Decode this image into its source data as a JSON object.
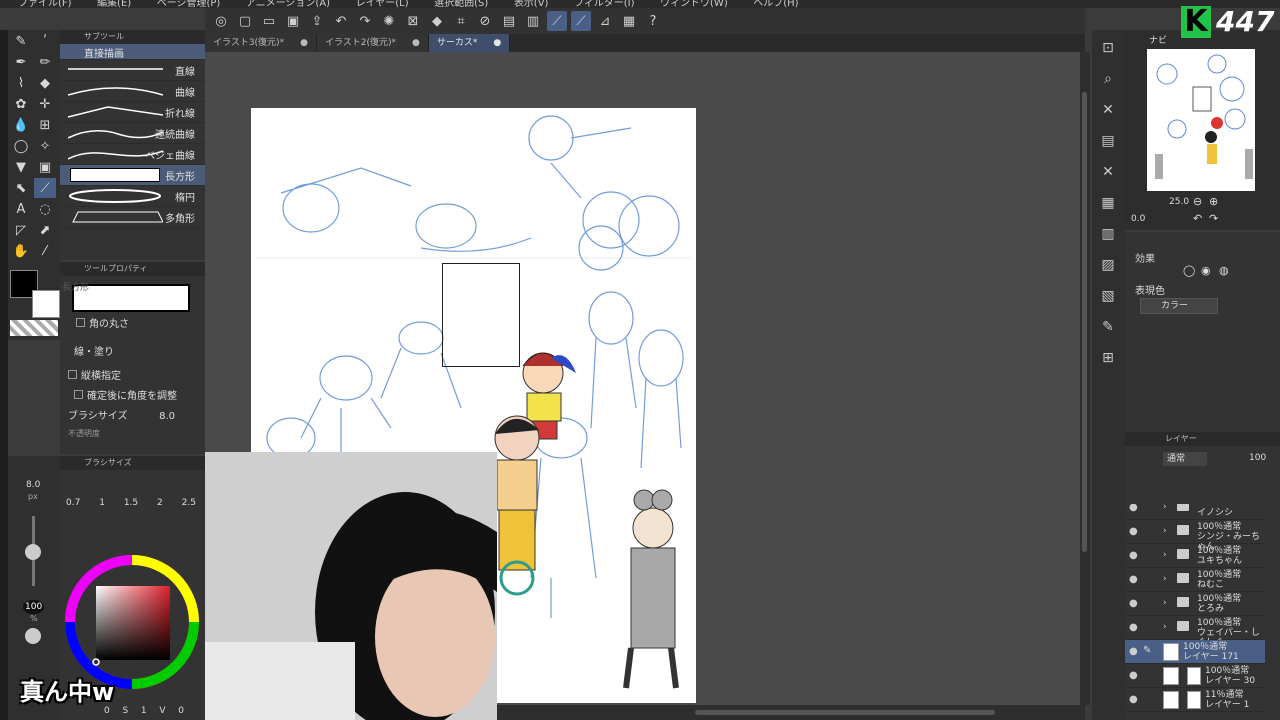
{
  "menu": [
    "ファイル(F)",
    "編集(E)",
    "ページ管理(P)",
    "アニメーション(A)",
    "レイヤー(L)",
    "選択範囲(S)",
    "表示(V)",
    "フィルター(I)",
    "ウィンドウ(W)",
    "ヘルプ(H)"
  ],
  "tabs": [
    {
      "label": "イラスト3(復元)*",
      "close": "●"
    },
    {
      "label": "イラスト2(復元)*",
      "close": "●"
    },
    {
      "label": "サーカス*",
      "close": "●"
    }
  ],
  "subtool": {
    "header": "サブツール",
    "items": [
      "直接描画",
      "直線",
      "曲線",
      "折れ線",
      "連続曲線",
      "ベジェ曲線",
      "長方形",
      "楕円",
      "多角形"
    ]
  },
  "tool_property": {
    "header": "ツールプロパティ",
    "shape_label": "長方形",
    "corner_round": "角の丸さ",
    "line_fill": "線・塗り",
    "aspect": "縦横指定",
    "adjust_angle": "確定後に角度を調整",
    "brush_size_label": "ブラシサイズ",
    "brush_size_value": "8.0",
    "more": "不透明度"
  },
  "brush_size_panel": {
    "header": "ブラシサイズ",
    "sizes": [
      "0.7",
      "1",
      "1.5",
      "2",
      "2.5"
    ],
    "side_value": "8.0",
    "side_unit": "px",
    "opacity": "100",
    "opacity_unit": "%",
    "bottom_values": [
      "0",
      "S",
      "1",
      "V",
      "0"
    ]
  },
  "navigator": {
    "label": "ナビ",
    "zoom": "25.0",
    "rotate": "0.0"
  },
  "effects": {
    "label": "効果",
    "expr_color_label": "表現色",
    "expr_color_value": "カラー"
  },
  "layers_panel": {
    "header": "レイヤー",
    "blend": "通常",
    "opacity": "100",
    "items": [
      {
        "l1": "",
        "l2": "イノシシ",
        "type": "folder"
      },
      {
        "l1": "100％通常",
        "l2": "シンジ・みーちゃん",
        "type": "folder"
      },
      {
        "l1": "100％通常",
        "l2": "ユキちゃん",
        "type": "folder"
      },
      {
        "l1": "100％通常",
        "l2": "ねむこ",
        "type": "folder"
      },
      {
        "l1": "100％通常",
        "l2": "とろみ",
        "type": "folder"
      },
      {
        "l1": "100％通常",
        "l2": "ウェイパー・しぐしぐ",
        "type": "folder"
      },
      {
        "l1": "100％通常",
        "l2": "レイヤー 171",
        "type": "raster",
        "selected": true
      },
      {
        "l1": "100％通常",
        "l2": "レイヤー 30",
        "type": "raster"
      },
      {
        "l1": "11％通常",
        "l2": "レイヤー 1",
        "type": "raster"
      }
    ]
  },
  "overlay": {
    "score_letter": "K",
    "score_value": "447",
    "caption": "真ん中w"
  },
  "colors": {
    "accent": "#4a5f86",
    "score_green": "#22c34a",
    "sketch_blue": "#5b8bd8"
  }
}
